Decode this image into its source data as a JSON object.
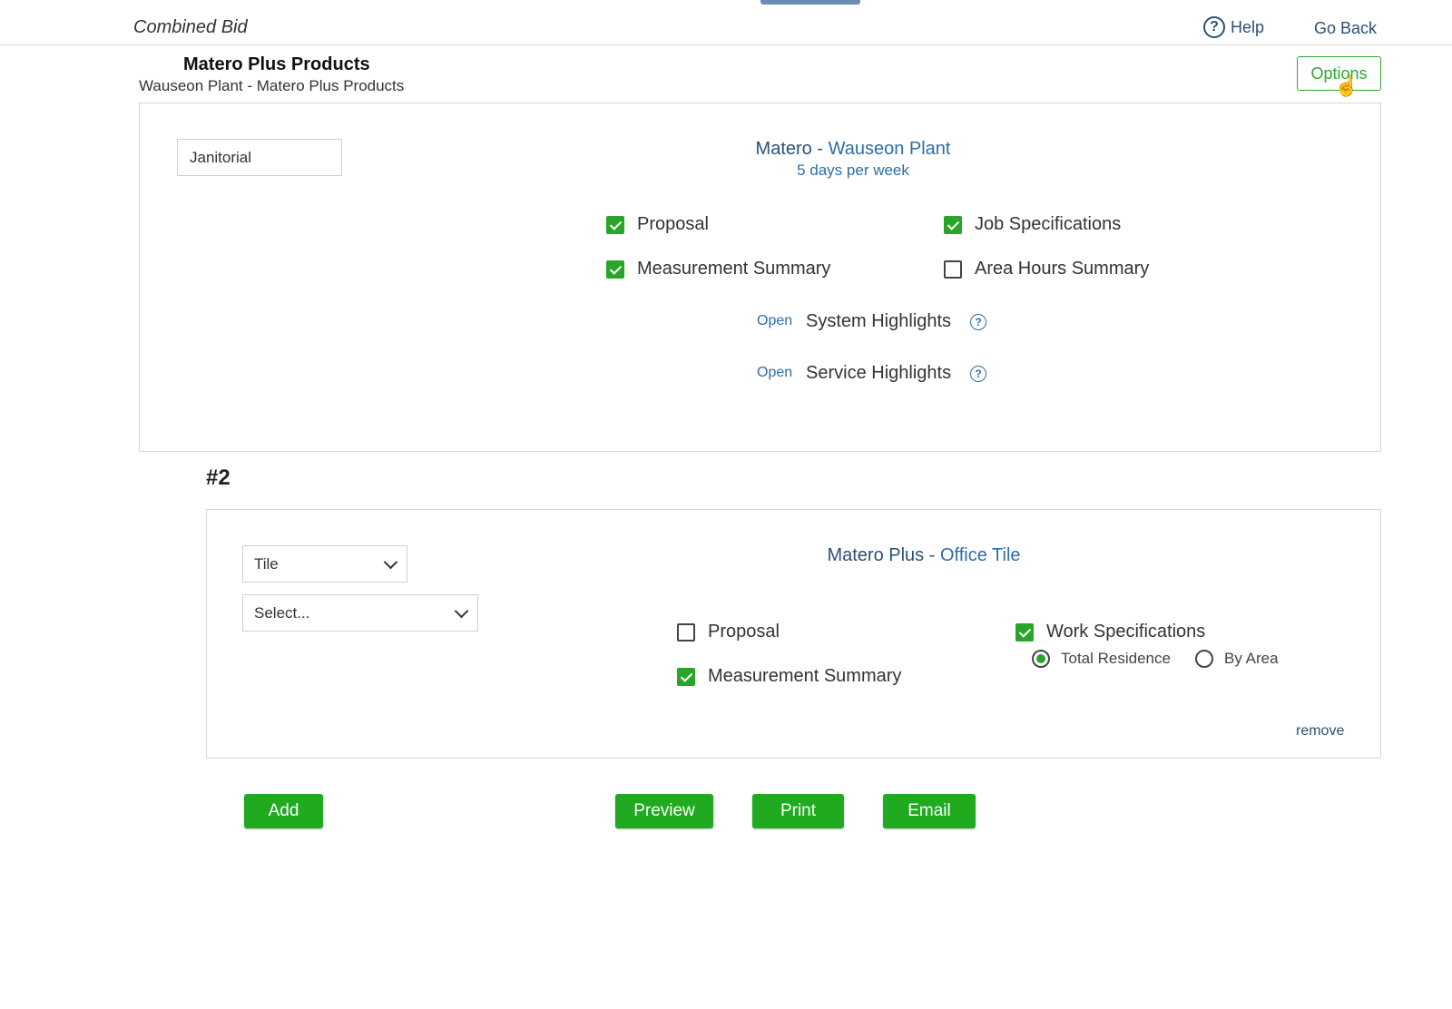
{
  "header": {
    "title": "Combined Bid",
    "help_label": "Help",
    "go_back_label": "Go Back"
  },
  "product": {
    "title": "Matero Plus Products",
    "subtitle": "Wauseon Plant - Matero Plus Products",
    "options_label": "Options"
  },
  "section1": {
    "service_value": "Janitorial",
    "site_prefix": "Matero - ",
    "site_name": "Wauseon Plant",
    "frequency": "5 days per week",
    "checkboxes": [
      {
        "label": "Proposal",
        "checked": true
      },
      {
        "label": "Job Specifications",
        "checked": true
      },
      {
        "label": "Measurement Summary",
        "checked": true
      },
      {
        "label": "Area Hours Summary",
        "checked": false
      }
    ],
    "highlights": [
      {
        "open_label": "Open",
        "label": "System Highlights"
      },
      {
        "open_label": "Open",
        "label": "Service Highlights"
      }
    ]
  },
  "section2": {
    "number": "#2",
    "type_select": "Tile",
    "item_select": "Select...",
    "site_prefix": "Matero Plus - ",
    "site_name": "Office Tile",
    "checkboxes": [
      {
        "label": "Proposal",
        "checked": false
      },
      {
        "label": "Work Specifications",
        "checked": true
      },
      {
        "label": "Measurement Summary",
        "checked": true
      }
    ],
    "radios": [
      {
        "label": "Total Residence",
        "selected": true
      },
      {
        "label": "By Area",
        "selected": false
      }
    ],
    "remove_label": "remove"
  },
  "actions": {
    "add": "Add",
    "preview": "Preview",
    "print": "Print",
    "email": "Email"
  },
  "colors": {
    "accent_green": "#1faa1f",
    "link_blue": "#2d6ea6",
    "heading_navy": "#2d4f73"
  }
}
